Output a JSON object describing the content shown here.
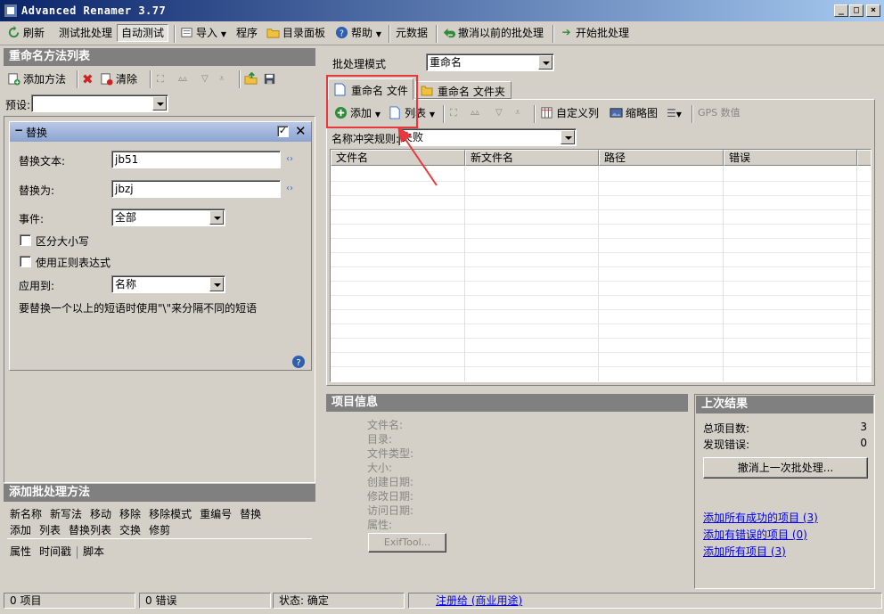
{
  "window": {
    "title": "Advanced Renamer 3.77"
  },
  "toolbar": {
    "refresh": "刷新",
    "test_batch": "测试批处理",
    "auto_test": "自动测试",
    "import": "导入",
    "program": "程序",
    "dir_panel": "目录面板",
    "help": "帮助",
    "metadata": "元数据",
    "undo_prev": "撤消以前的批处理",
    "start_batch": "开始批处理"
  },
  "methods_panel": {
    "header": "重命名方法列表",
    "add_method": "添加方法",
    "clear": "清除",
    "preset_label": "预设:",
    "preset_value": ""
  },
  "replace_method": {
    "title": "替换",
    "replace_text_label": "替换文本:",
    "replace_text_value": "jb51",
    "replace_with_label": "替换为:",
    "replace_with_value": "jbzj",
    "occurrence_label": "事件:",
    "occurrence_value": "全部",
    "case_sensitive_label": "区分大小写",
    "regex_label": "使用正则表达式",
    "apply_to_label": "应用到:",
    "apply_to_value": "名称",
    "hint": "要替换一个以上的短语时使用\"\\\"来分隔不同的短语"
  },
  "add_batch_panel": {
    "header": "添加批处理方法",
    "row1": [
      "新名称",
      "新写法",
      "移动",
      "移除",
      "移除模式",
      "重编号",
      "替换"
    ],
    "row2": [
      "添加",
      "列表",
      "替换列表",
      "交换",
      "修剪"
    ],
    "row3a": [
      "属性",
      "时间戳"
    ],
    "row3b": [
      "脚本"
    ]
  },
  "batch_mode": {
    "label": "批处理模式",
    "value": "重命名"
  },
  "tabs": {
    "files": "重命名 文件",
    "folders": "重命名 文件夹"
  },
  "files_toolbar": {
    "add": "添加",
    "list": "列表",
    "custom_columns": "自定义列",
    "thumbnail": "缩略图",
    "gps": "GPS 数值"
  },
  "conflict": {
    "label": "名称冲突规则:",
    "value": "失败"
  },
  "columns": [
    "文件名",
    "新文件名",
    "路径",
    "错误"
  ],
  "item_info": {
    "header": "项目信息",
    "fields": [
      "文件名:",
      "目录:",
      "文件类型:",
      "大小:",
      "创建日期:",
      "修改日期:",
      "访问日期:",
      "属性:"
    ],
    "exiftool": "ExifTool..."
  },
  "last_result": {
    "header": "上次结果",
    "total_label": "总项目数:",
    "total_value": "3",
    "errors_label": "发现错误:",
    "errors_value": "0",
    "undo_last": "撤消上一次批处理...",
    "link_success": "添加所有成功的项目 (3)",
    "link_errors": "添加有错误的项目 (0)",
    "link_all": "添加所有项目 (3)"
  },
  "status": {
    "items": "0 项目",
    "errors": "0 错误",
    "state": "状态:  确定",
    "register": "注册给 (商业用途)"
  },
  "colors": {
    "annotation_red": "#e8383d",
    "link_blue": "#0000ee",
    "panel_header": "#808080"
  }
}
